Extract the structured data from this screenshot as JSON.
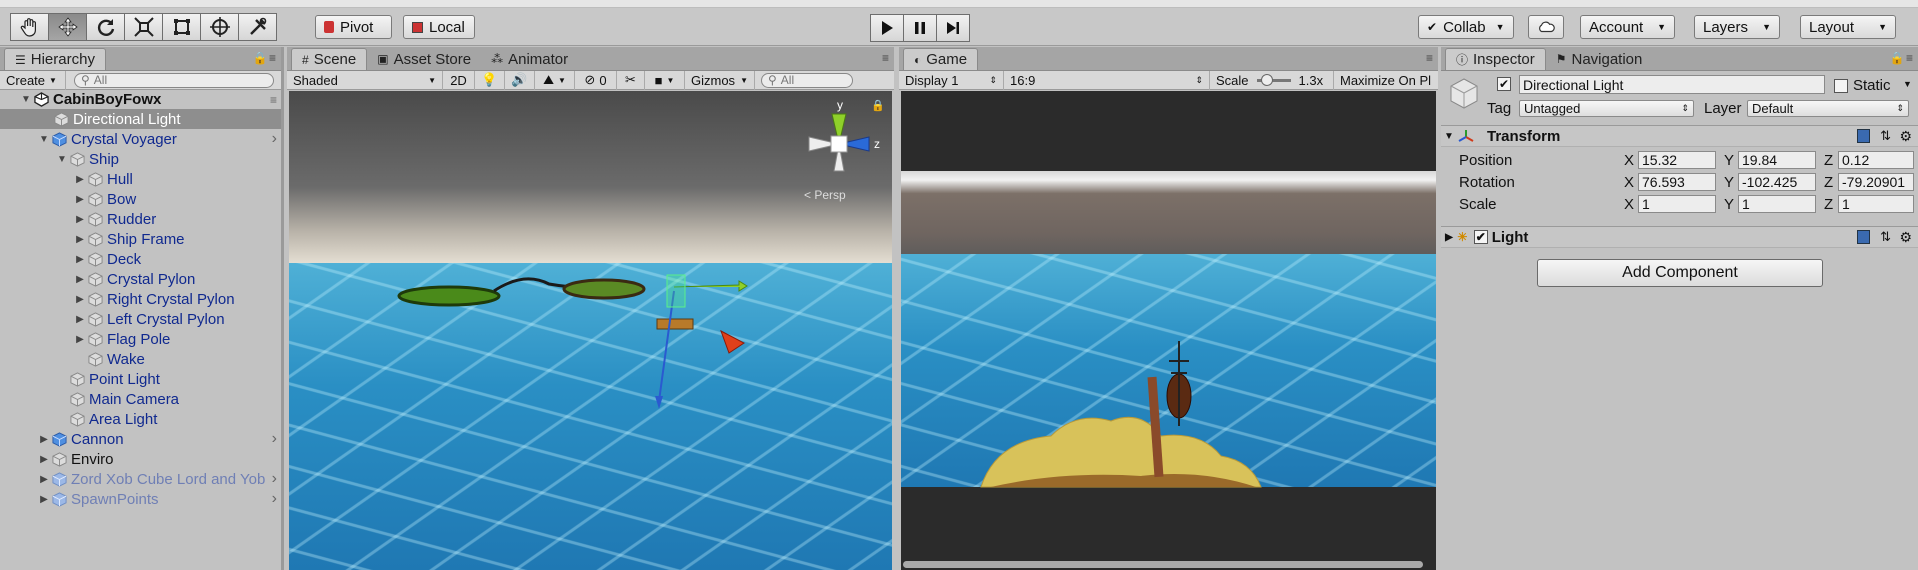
{
  "toolbar": {
    "tools": [
      "hand-tool-icon",
      "move-tool-icon",
      "rotate-tool-icon",
      "scale-tool-icon",
      "rect-tool-icon",
      "transform-tool-icon",
      "custom-tool-icon"
    ],
    "pivot_label": "Pivot",
    "local_label": "Local",
    "collab_label": "Collab",
    "account_label": "Account",
    "layers_label": "Layers",
    "layout_label": "Layout"
  },
  "hierarchy": {
    "tab_label": "Hierarchy",
    "create_label": "Create",
    "search_placeholder": "All",
    "scene_name": "CabinBoyFowx",
    "items": [
      {
        "label": "Directional Light"
      },
      {
        "label": "Crystal Voyager"
      },
      {
        "label": "Ship"
      },
      {
        "label": "Hull"
      },
      {
        "label": "Bow"
      },
      {
        "label": "Rudder"
      },
      {
        "label": "Ship Frame"
      },
      {
        "label": "Deck"
      },
      {
        "label": "Crystal Pylon"
      },
      {
        "label": "Right Crystal Pylon"
      },
      {
        "label": "Left Crystal Pylon"
      },
      {
        "label": "Flag Pole"
      },
      {
        "label": "Wake"
      },
      {
        "label": "Point Light"
      },
      {
        "label": "Main Camera"
      },
      {
        "label": "Area Light"
      },
      {
        "label": "Cannon"
      },
      {
        "label": "Enviro"
      },
      {
        "label": "Zord Xob Cube Lord and Yob"
      },
      {
        "label": "SpawnPoints"
      }
    ]
  },
  "scene": {
    "tabs": [
      "Scene",
      "Asset Store",
      "Animator"
    ],
    "shading": "Shaded",
    "mode_2d": "2D",
    "hidden_count": "0",
    "gizmos_label": "Gizmos",
    "search_placeholder": "All",
    "persp_label": "< Persp",
    "axis_y": "y",
    "axis_z": "z"
  },
  "game": {
    "tab_label": "Game",
    "display": "Display 1",
    "aspect": "16:9",
    "scale_label": "Scale",
    "scale_value": "1.3x",
    "maximize_label": "Maximize On Pl"
  },
  "inspector": {
    "tabs": [
      "Inspector",
      "Navigation"
    ],
    "object_name": "Directional Light",
    "static_label": "Static",
    "tag_label": "Tag",
    "tag_value": "Untagged",
    "layer_label": "Layer",
    "layer_value": "Default",
    "transform": {
      "title": "Transform",
      "rows": [
        {
          "label": "Position",
          "x": "15.32",
          "y": "19.84",
          "z": "0.12"
        },
        {
          "label": "Rotation",
          "x": "76.593",
          "y": "-102.425",
          "z": "-79.20901"
        },
        {
          "label": "Scale",
          "x": "1",
          "y": "1",
          "z": "1"
        }
      ],
      "axis_x": "X",
      "axis_y": "Y",
      "axis_z": "Z"
    },
    "light_title": "Light",
    "add_component_label": "Add Component"
  },
  "colors": {
    "selection": "#8e8e8e",
    "prefab_blue": "#10298f",
    "water": "#2a8fc4"
  }
}
